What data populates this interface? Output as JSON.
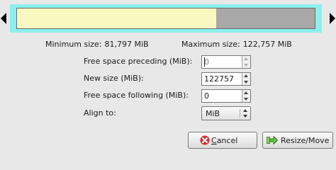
{
  "partition": {
    "used_fraction": 0.67,
    "frame_color": "#8df0ec",
    "used_color": "#f8f8c0",
    "unused_color": "#a8a8a8"
  },
  "size_info": {
    "min_label": "Minimum size:",
    "min_value": "81,797 MiB",
    "max_label": "Maximum size:",
    "max_value": "122,757 MiB"
  },
  "fields": {
    "free_preceding": {
      "label": "Free space preceding (MiB):",
      "value": "0"
    },
    "new_size": {
      "label": "New size (MiB):",
      "value": "122757"
    },
    "free_following": {
      "label": "Free space following (MiB):",
      "value": "0"
    },
    "align": {
      "label": "Align to:",
      "value": "MiB"
    }
  },
  "buttons": {
    "cancel_first": "C",
    "cancel_rest": "ancel",
    "resize_label": "Resize/Move"
  }
}
